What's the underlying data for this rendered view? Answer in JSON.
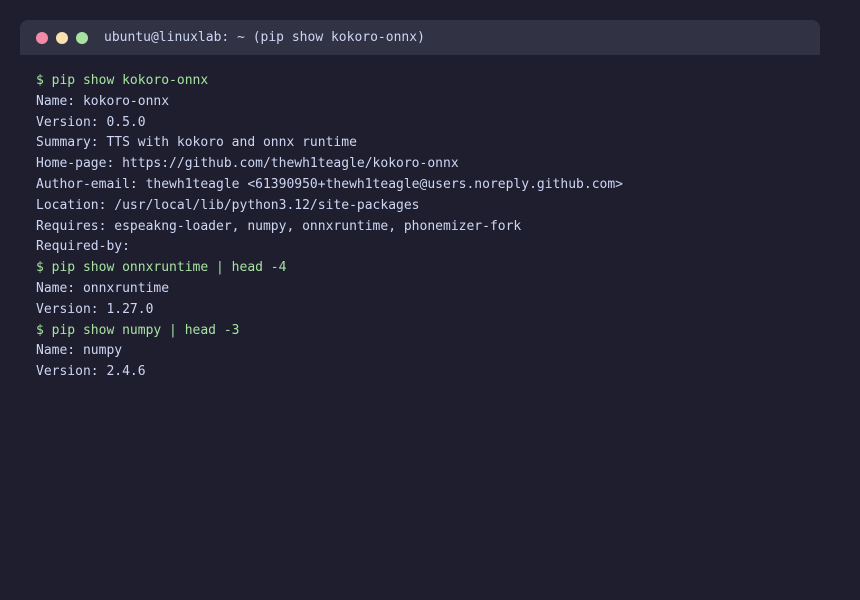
{
  "window": {
    "title": "ubuntu@linuxlab: ~ (pip show kokoro-onnx)",
    "colors": {
      "background": "#1e1e2e",
      "titlebar": "#313244",
      "text": "#cdd6f4",
      "command": "#a6e3a1",
      "close": "#f38ba8",
      "minimize": "#f9e2af",
      "maximize": "#a6e3a1"
    }
  },
  "terminal": {
    "lines": [
      {
        "type": "cmd",
        "text": "$ pip show kokoro-onnx"
      },
      {
        "type": "out",
        "text": "Name: kokoro-onnx"
      },
      {
        "type": "out",
        "text": "Version: 0.5.0"
      },
      {
        "type": "out",
        "text": "Summary: TTS with kokoro and onnx runtime"
      },
      {
        "type": "out",
        "text": "Home-page: https://github.com/thewh1teagle/kokoro-onnx"
      },
      {
        "type": "out",
        "text": "Author-email: thewh1teagle <61390950+thewh1teagle@users.noreply.github.com>"
      },
      {
        "type": "out",
        "text": "Location: /usr/local/lib/python3.12/site-packages"
      },
      {
        "type": "out",
        "text": "Requires: espeakng-loader, numpy, onnxruntime, phonemizer-fork"
      },
      {
        "type": "out",
        "text": "Required-by:"
      },
      {
        "type": "cmd",
        "text": "$ pip show onnxruntime | head -4"
      },
      {
        "type": "out",
        "text": "Name: onnxruntime"
      },
      {
        "type": "out",
        "text": "Version: 1.27.0"
      },
      {
        "type": "cmd",
        "text": "$ pip show numpy | head -3"
      },
      {
        "type": "out",
        "text": "Name: numpy"
      },
      {
        "type": "out",
        "text": "Version: 2.4.6"
      }
    ]
  }
}
